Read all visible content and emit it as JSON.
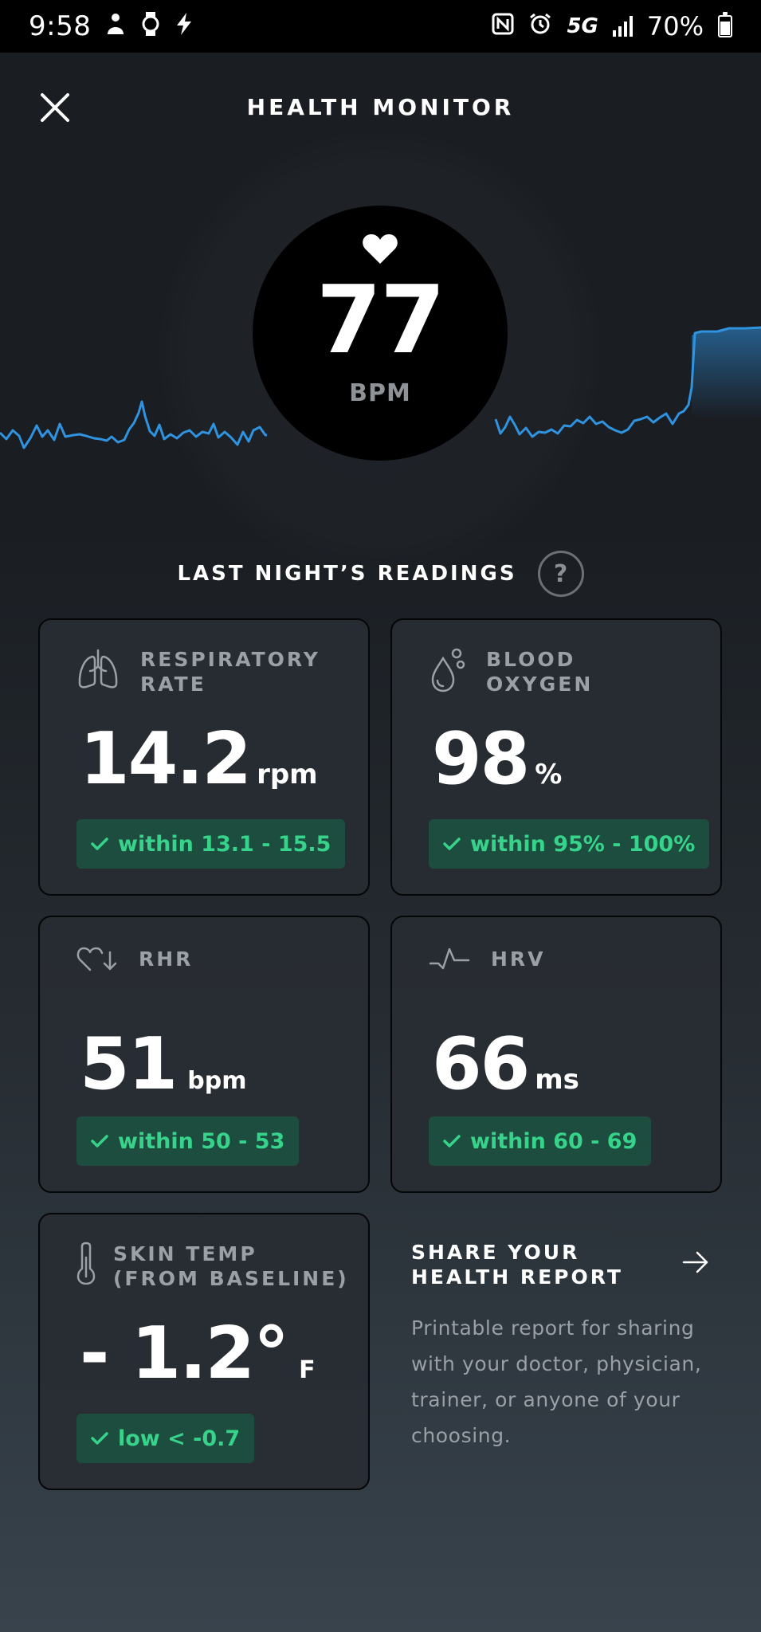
{
  "status_bar": {
    "time": "9:58",
    "network": "5G",
    "battery": "70%"
  },
  "header": {
    "title": "HEALTH MONITOR"
  },
  "heart_rate": {
    "value": "77",
    "unit": "BPM"
  },
  "section": {
    "title": "LAST NIGHT’S READINGS",
    "help_label": "?"
  },
  "cards": {
    "respiratory": {
      "label_line1": "RESPIRATORY",
      "label_line2": "RATE",
      "value": "14.2",
      "unit": "rpm",
      "range": "within 13.1 - 15.5"
    },
    "blood_oxygen": {
      "label_line1": "BLOOD",
      "label_line2": "OXYGEN",
      "value": "98",
      "unit": "%",
      "range": "within 95% - 100%"
    },
    "rhr": {
      "label": "RHR",
      "value": "51",
      "unit": "bpm",
      "range": "within 50 - 53"
    },
    "hrv": {
      "label": "HRV",
      "value": "66",
      "unit": "ms",
      "range": "within 60 - 69"
    },
    "skin_temp": {
      "label_line1": "SKIN TEMP",
      "label_line2": "(FROM BASELINE)",
      "value": "- 1.2°",
      "unit": "F",
      "range": "low < -0.7"
    }
  },
  "share": {
    "title": "SHARE YOUR HEALTH REPORT",
    "description": "Printable report for sharing with your doctor, physician, trainer, or anyone of your choosing."
  },
  "colors": {
    "accent_line": "#2f93e0",
    "badge_bg": "#1c4d3e",
    "badge_text": "#37d38b"
  },
  "icons": {
    "close": "close-icon",
    "heart": "heart-icon",
    "lungs": "lungs-icon",
    "drop": "water-drop-icon",
    "rhr": "heart-down-icon",
    "hrv": "pulse-icon",
    "thermometer": "thermometer-icon",
    "arrow": "arrow-right-icon"
  }
}
